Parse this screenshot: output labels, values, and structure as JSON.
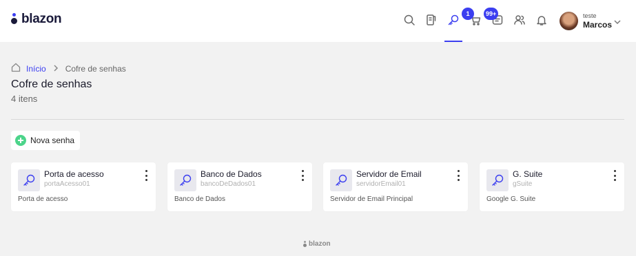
{
  "brand": {
    "name": "blazon",
    "accent": "#3b3ef0",
    "dark": "#1a1a3a"
  },
  "topnav": {
    "icons": [
      "search-icon",
      "tasks-icon",
      "key-icon",
      "cart-icon",
      "messages-icon",
      "users-icon",
      "bell-icon"
    ],
    "active": "key-icon",
    "cart_badge": "1",
    "messages_badge": "99+"
  },
  "user": {
    "role": "teste",
    "name": "Marcos"
  },
  "breadcrumb": {
    "home": "Início",
    "current": "Cofre de senhas"
  },
  "page": {
    "title": "Cofre de senhas",
    "count": "4 itens"
  },
  "actions": {
    "new_label": "Nova senha",
    "new_color": "#4cd48a"
  },
  "cards": [
    {
      "title": "Porta de acesso",
      "username": "portaAcesso01",
      "description": "Porta de acesso"
    },
    {
      "title": "Banco de Dados",
      "username": "bancoDeDados01",
      "description": "Banco de Dados"
    },
    {
      "title": "Servidor de Email",
      "username": "servidorEmail01",
      "description": "Servidor de Email Principal"
    },
    {
      "title": "G. Suite",
      "username": "gSuite",
      "description": "Google G. Suite"
    }
  ],
  "footer": {
    "brand": "blazon"
  }
}
